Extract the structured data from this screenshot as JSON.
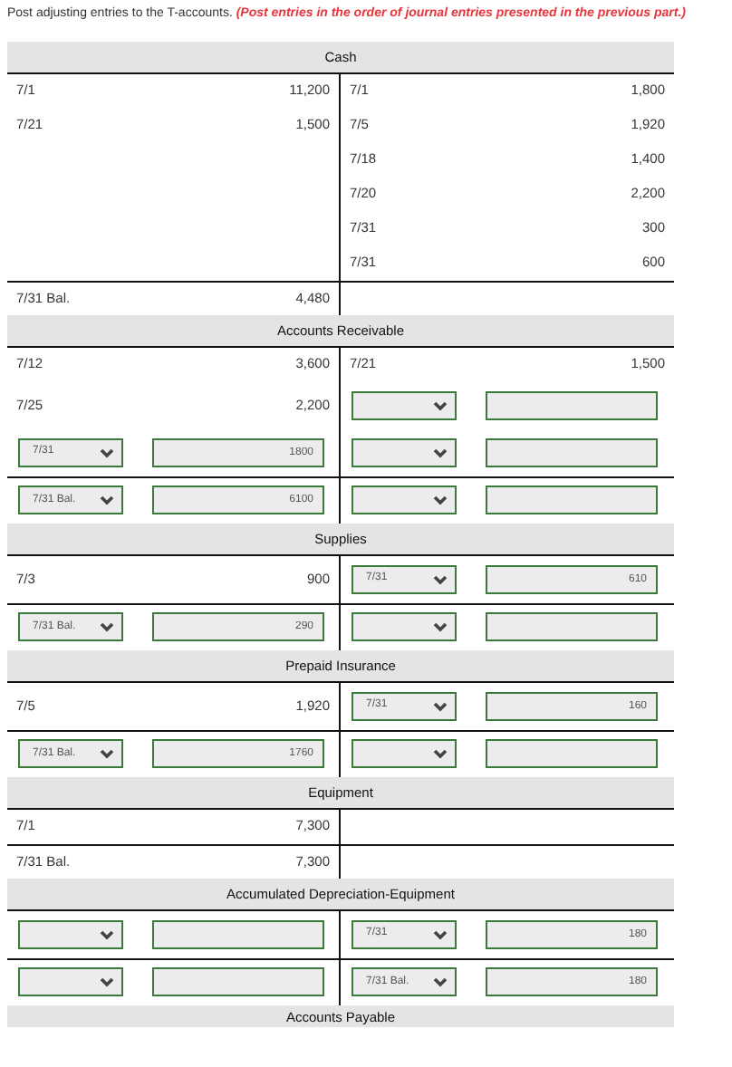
{
  "instruction": "Post adjusting entries to the T-accounts.",
  "note": "(Post entries in the order of journal entries presented in the previous part.)",
  "accounts": [
    {
      "title": "Cash",
      "entries": [
        {
          "left": {
            "kind": "text",
            "date": "7/1",
            "amount": "11,200"
          },
          "right": {
            "kind": "text",
            "date": "7/1",
            "amount": "1,800"
          }
        },
        {
          "left": {
            "kind": "text",
            "date": "7/21",
            "amount": "1,500"
          },
          "right": {
            "kind": "text",
            "date": "7/5",
            "amount": "1,920"
          }
        },
        {
          "right": {
            "kind": "text",
            "date": "7/18",
            "amount": "1,400"
          }
        },
        {
          "right": {
            "kind": "text",
            "date": "7/20",
            "amount": "2,200"
          }
        },
        {
          "right": {
            "kind": "text",
            "date": "7/31",
            "amount": "300"
          }
        },
        {
          "right": {
            "kind": "text",
            "date": "7/31",
            "amount": "600"
          }
        }
      ],
      "balance": [
        {
          "left": {
            "kind": "text",
            "date": "7/31 Bal.",
            "amount": "4,480"
          }
        }
      ]
    },
    {
      "title": "Accounts Receivable",
      "entries": [
        {
          "left": {
            "kind": "text",
            "date": "7/12",
            "amount": "3,600"
          },
          "right": {
            "kind": "text",
            "date": "7/21",
            "amount": "1,500"
          }
        },
        {
          "left": {
            "kind": "text",
            "date": "7/25",
            "amount": "2,200"
          },
          "right": {
            "kind": "input"
          }
        },
        {
          "left": {
            "kind": "input",
            "date": "7/31",
            "amount": "1800"
          },
          "right": {
            "kind": "input"
          }
        }
      ],
      "balance": [
        {
          "left": {
            "kind": "input",
            "date": "7/31 Bal.",
            "amount": "6100"
          },
          "right": {
            "kind": "input"
          }
        }
      ]
    },
    {
      "title": "Supplies",
      "entries": [
        {
          "left": {
            "kind": "text",
            "date": "7/3",
            "amount": "900"
          },
          "right": {
            "kind": "input",
            "date": "7/31",
            "amount": "610"
          }
        }
      ],
      "balance": [
        {
          "left": {
            "kind": "input",
            "date": "7/31 Bal.",
            "amount": "290"
          },
          "right": {
            "kind": "input"
          }
        }
      ]
    },
    {
      "title": "Prepaid Insurance",
      "entries": [
        {
          "left": {
            "kind": "text",
            "date": "7/5",
            "amount": "1,920"
          },
          "right": {
            "kind": "input",
            "date": "7/31",
            "amount": "160"
          }
        }
      ],
      "balance": [
        {
          "left": {
            "kind": "input",
            "date": "7/31 Bal.",
            "amount": "1760"
          },
          "right": {
            "kind": "input"
          }
        }
      ]
    },
    {
      "title": "Equipment",
      "entries": [
        {
          "left": {
            "kind": "text",
            "date": "7/1",
            "amount": "7,300"
          }
        }
      ],
      "balance": [
        {
          "left": {
            "kind": "text",
            "date": "7/31 Bal.",
            "amount": "7,300"
          }
        }
      ]
    },
    {
      "title": "Accumulated Depreciation-Equipment",
      "entries": [
        {
          "left": {
            "kind": "input"
          },
          "right": {
            "kind": "input",
            "date": "7/31",
            "amount": "180"
          }
        }
      ],
      "balance": [
        {
          "left": {
            "kind": "input"
          },
          "right": {
            "kind": "input",
            "date": "7/31 Bal.",
            "amount": "180"
          }
        }
      ]
    },
    {
      "title": "Accounts Payable"
    }
  ]
}
